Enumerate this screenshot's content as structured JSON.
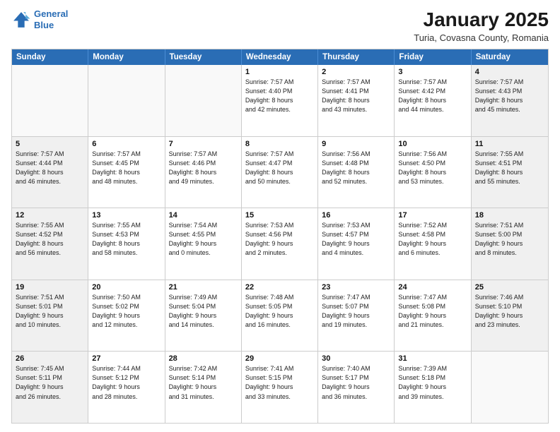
{
  "logo": {
    "line1": "General",
    "line2": "Blue"
  },
  "title": "January 2025",
  "subtitle": "Turia, Covasna County, Romania",
  "header_days": [
    "Sunday",
    "Monday",
    "Tuesday",
    "Wednesday",
    "Thursday",
    "Friday",
    "Saturday"
  ],
  "weeks": [
    [
      {
        "day": "",
        "info": "",
        "empty": true
      },
      {
        "day": "",
        "info": "",
        "empty": true
      },
      {
        "day": "",
        "info": "",
        "empty": true
      },
      {
        "day": "1",
        "info": "Sunrise: 7:57 AM\nSunset: 4:40 PM\nDaylight: 8 hours\nand 42 minutes.",
        "empty": false
      },
      {
        "day": "2",
        "info": "Sunrise: 7:57 AM\nSunset: 4:41 PM\nDaylight: 8 hours\nand 43 minutes.",
        "empty": false
      },
      {
        "day": "3",
        "info": "Sunrise: 7:57 AM\nSunset: 4:42 PM\nDaylight: 8 hours\nand 44 minutes.",
        "empty": false
      },
      {
        "day": "4",
        "info": "Sunrise: 7:57 AM\nSunset: 4:43 PM\nDaylight: 8 hours\nand 45 minutes.",
        "empty": false,
        "shaded": true
      }
    ],
    [
      {
        "day": "5",
        "info": "Sunrise: 7:57 AM\nSunset: 4:44 PM\nDaylight: 8 hours\nand 46 minutes.",
        "empty": false,
        "shaded": true
      },
      {
        "day": "6",
        "info": "Sunrise: 7:57 AM\nSunset: 4:45 PM\nDaylight: 8 hours\nand 48 minutes.",
        "empty": false
      },
      {
        "day": "7",
        "info": "Sunrise: 7:57 AM\nSunset: 4:46 PM\nDaylight: 8 hours\nand 49 minutes.",
        "empty": false
      },
      {
        "day": "8",
        "info": "Sunrise: 7:57 AM\nSunset: 4:47 PM\nDaylight: 8 hours\nand 50 minutes.",
        "empty": false
      },
      {
        "day": "9",
        "info": "Sunrise: 7:56 AM\nSunset: 4:48 PM\nDaylight: 8 hours\nand 52 minutes.",
        "empty": false
      },
      {
        "day": "10",
        "info": "Sunrise: 7:56 AM\nSunset: 4:50 PM\nDaylight: 8 hours\nand 53 minutes.",
        "empty": false
      },
      {
        "day": "11",
        "info": "Sunrise: 7:55 AM\nSunset: 4:51 PM\nDaylight: 8 hours\nand 55 minutes.",
        "empty": false,
        "shaded": true
      }
    ],
    [
      {
        "day": "12",
        "info": "Sunrise: 7:55 AM\nSunset: 4:52 PM\nDaylight: 8 hours\nand 56 minutes.",
        "empty": false,
        "shaded": true
      },
      {
        "day": "13",
        "info": "Sunrise: 7:55 AM\nSunset: 4:53 PM\nDaylight: 8 hours\nand 58 minutes.",
        "empty": false
      },
      {
        "day": "14",
        "info": "Sunrise: 7:54 AM\nSunset: 4:55 PM\nDaylight: 9 hours\nand 0 minutes.",
        "empty": false
      },
      {
        "day": "15",
        "info": "Sunrise: 7:53 AM\nSunset: 4:56 PM\nDaylight: 9 hours\nand 2 minutes.",
        "empty": false
      },
      {
        "day": "16",
        "info": "Sunrise: 7:53 AM\nSunset: 4:57 PM\nDaylight: 9 hours\nand 4 minutes.",
        "empty": false
      },
      {
        "day": "17",
        "info": "Sunrise: 7:52 AM\nSunset: 4:58 PM\nDaylight: 9 hours\nand 6 minutes.",
        "empty": false
      },
      {
        "day": "18",
        "info": "Sunrise: 7:51 AM\nSunset: 5:00 PM\nDaylight: 9 hours\nand 8 minutes.",
        "empty": false,
        "shaded": true
      }
    ],
    [
      {
        "day": "19",
        "info": "Sunrise: 7:51 AM\nSunset: 5:01 PM\nDaylight: 9 hours\nand 10 minutes.",
        "empty": false,
        "shaded": true
      },
      {
        "day": "20",
        "info": "Sunrise: 7:50 AM\nSunset: 5:02 PM\nDaylight: 9 hours\nand 12 minutes.",
        "empty": false
      },
      {
        "day": "21",
        "info": "Sunrise: 7:49 AM\nSunset: 5:04 PM\nDaylight: 9 hours\nand 14 minutes.",
        "empty": false
      },
      {
        "day": "22",
        "info": "Sunrise: 7:48 AM\nSunset: 5:05 PM\nDaylight: 9 hours\nand 16 minutes.",
        "empty": false
      },
      {
        "day": "23",
        "info": "Sunrise: 7:47 AM\nSunset: 5:07 PM\nDaylight: 9 hours\nand 19 minutes.",
        "empty": false
      },
      {
        "day": "24",
        "info": "Sunrise: 7:47 AM\nSunset: 5:08 PM\nDaylight: 9 hours\nand 21 minutes.",
        "empty": false
      },
      {
        "day": "25",
        "info": "Sunrise: 7:46 AM\nSunset: 5:10 PM\nDaylight: 9 hours\nand 23 minutes.",
        "empty": false,
        "shaded": true
      }
    ],
    [
      {
        "day": "26",
        "info": "Sunrise: 7:45 AM\nSunset: 5:11 PM\nDaylight: 9 hours\nand 26 minutes.",
        "empty": false,
        "shaded": true
      },
      {
        "day": "27",
        "info": "Sunrise: 7:44 AM\nSunset: 5:12 PM\nDaylight: 9 hours\nand 28 minutes.",
        "empty": false
      },
      {
        "day": "28",
        "info": "Sunrise: 7:42 AM\nSunset: 5:14 PM\nDaylight: 9 hours\nand 31 minutes.",
        "empty": false
      },
      {
        "day": "29",
        "info": "Sunrise: 7:41 AM\nSunset: 5:15 PM\nDaylight: 9 hours\nand 33 minutes.",
        "empty": false
      },
      {
        "day": "30",
        "info": "Sunrise: 7:40 AM\nSunset: 5:17 PM\nDaylight: 9 hours\nand 36 minutes.",
        "empty": false
      },
      {
        "day": "31",
        "info": "Sunrise: 7:39 AM\nSunset: 5:18 PM\nDaylight: 9 hours\nand 39 minutes.",
        "empty": false
      },
      {
        "day": "",
        "info": "",
        "empty": true,
        "shaded": true
      }
    ]
  ]
}
